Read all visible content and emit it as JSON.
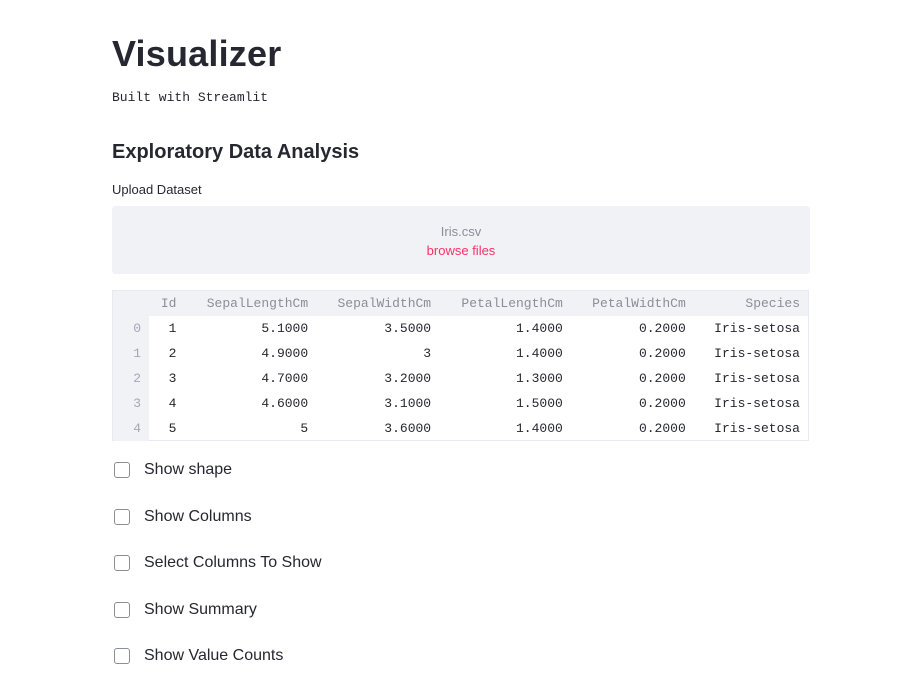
{
  "app": {
    "title": "Visualizer",
    "subtitle": "Built with Streamlit"
  },
  "eda": {
    "heading": "Exploratory Data Analysis",
    "upload_label": "Upload Dataset",
    "uploaded_filename": "Iris.csv",
    "browse_label": "browse files"
  },
  "dataframe": {
    "columns": [
      "Id",
      "SepalLengthCm",
      "SepalWidthCm",
      "PetalLengthCm",
      "PetalWidthCm",
      "Species"
    ],
    "rows": [
      {
        "index": "0",
        "cells": [
          "1",
          "5.1000",
          "3.5000",
          "1.4000",
          "0.2000",
          "Iris-setosa"
        ]
      },
      {
        "index": "1",
        "cells": [
          "2",
          "4.9000",
          "3",
          "1.4000",
          "0.2000",
          "Iris-setosa"
        ]
      },
      {
        "index": "2",
        "cells": [
          "3",
          "4.7000",
          "3.2000",
          "1.3000",
          "0.2000",
          "Iris-setosa"
        ]
      },
      {
        "index": "3",
        "cells": [
          "4",
          "4.6000",
          "3.1000",
          "1.5000",
          "0.2000",
          "Iris-setosa"
        ]
      },
      {
        "index": "4",
        "cells": [
          "5",
          "5",
          "3.6000",
          "1.4000",
          "0.2000",
          "Iris-setosa"
        ]
      }
    ]
  },
  "options": [
    {
      "label": "Show shape",
      "checked": false
    },
    {
      "label": "Show Columns",
      "checked": false
    },
    {
      "label": "Select Columns To Show",
      "checked": false
    },
    {
      "label": "Show Summary",
      "checked": false
    },
    {
      "label": "Show Value Counts",
      "checked": false
    }
  ],
  "colors": {
    "accent": "#f63366",
    "text": "#262730",
    "muted": "#8b8d98",
    "panel": "#f0f2f6"
  }
}
